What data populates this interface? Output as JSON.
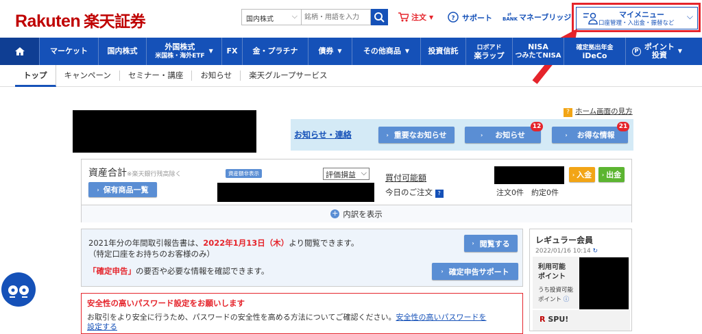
{
  "header": {
    "logo_en": "Rakuten",
    "logo_jp": "楽天証券",
    "market_select": "国内株式",
    "search_placeholder": "銘柄・用語を入力",
    "order": "注文",
    "support": "サポート",
    "bank_badge": "BANK",
    "money_bridge": "マネーブリッジ",
    "mymenu_title": "マイメニュー",
    "mymenu_sub": "口座管理・入出金・振替など"
  },
  "nav": {
    "market": "マーケット",
    "domestic": "国内株式",
    "foreign1": "外国株式",
    "foreign2": "米国株・海外ETF",
    "fx": "FX",
    "gold": "金・プラチナ",
    "bond": "債券",
    "other": "その他商品",
    "fund": "投資信託",
    "robo1": "ロボアド",
    "robo2": "楽ラップ",
    "nisa1": "NISA",
    "nisa2": "つみたてNISA",
    "ideco1": "確定拠出年金",
    "ideco2": "iDeCo",
    "point1": "ポイント",
    "point2": "投資"
  },
  "subnav": [
    "トップ",
    "キャンペーン",
    "セミナー・講座",
    "お知らせ",
    "楽天グループサービス"
  ],
  "notice": {
    "howto": "ホーム画面の見方",
    "label": "お知らせ・連絡",
    "important": "重要なお知らせ",
    "news": "お知らせ",
    "news_count": "12",
    "deals": "お得な情報",
    "deals_count": "21"
  },
  "assets": {
    "total": "資産合計",
    "excl": "※楽天銀行残高除く",
    "hide_badge": "資産額非表示",
    "holdings_btn": "保有商品一覧",
    "eval_select": "評価損益",
    "buying_power": "買付可能額",
    "today_orders": "今日のご注文",
    "orders_count": "注文0件　約定0件",
    "deposit": "入金",
    "withdraw": "出金",
    "breakdown": "内訳を表示"
  },
  "report": {
    "line1_a": "2021年分の年間取引報告書は、",
    "line1_date": "2022年1月13日（木）",
    "line1_b": "より閲覧できます。",
    "line2": "（特定口座をお持ちのお客様のみ）",
    "view_btn": "閲覧する",
    "tax_q": "「確定申告」",
    "tax_rest": "の要否や必要な情報を確認できます。",
    "tax_btn": "確定申告サポート"
  },
  "password": {
    "title": "安全性の高いパスワード設定をお願いします",
    "body": "お取引をより安全に行うため、パスワードの安全性を高める方法についてご確認ください。",
    "link": "安全性の高いパスワードを",
    "overflow": "設定する"
  },
  "member": {
    "title": "レギュラー会員",
    "date": "2022/01/16 10:14",
    "points": "利用可能",
    "points2": "ポイント",
    "invest1": "うち投資可能",
    "invest2": "ポイント",
    "spu": "SPU!"
  },
  "colors": {
    "brand": "#bf0000",
    "nav": "#1551b8",
    "alert": "#e5242b"
  }
}
